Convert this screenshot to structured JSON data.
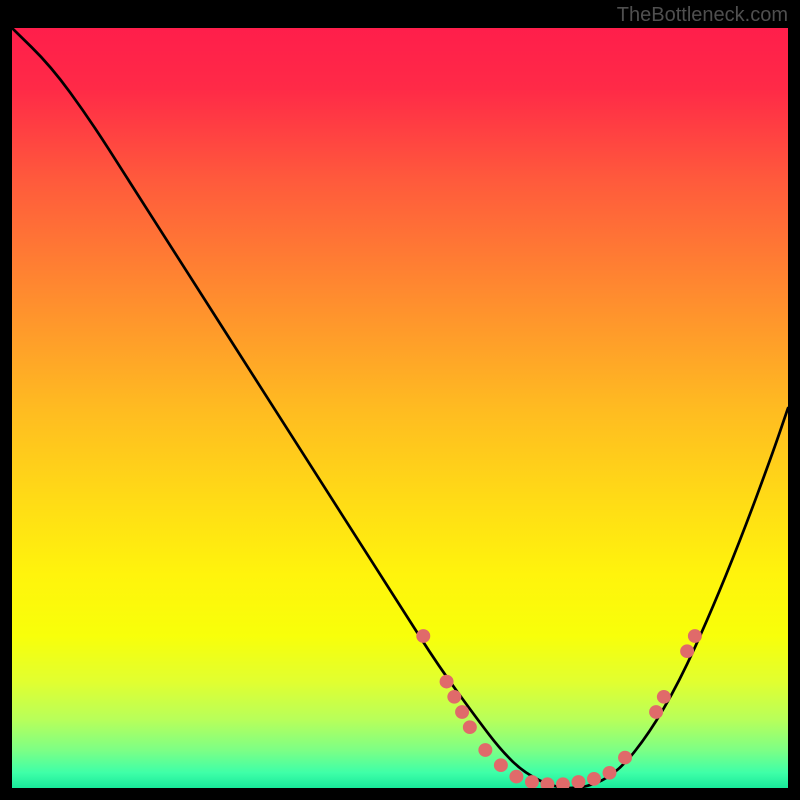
{
  "watermark": "TheBottleneck.com",
  "chart_data": {
    "type": "line",
    "title": "",
    "xlabel": "",
    "ylabel": "",
    "xlim": [
      0,
      100
    ],
    "ylim": [
      0,
      100
    ],
    "grid": false,
    "legend": false,
    "gradient_stops": [
      {
        "offset": "0%",
        "color": "#ff1e4b"
      },
      {
        "offset": "8%",
        "color": "#ff2a47"
      },
      {
        "offset": "20%",
        "color": "#ff5a3c"
      },
      {
        "offset": "35%",
        "color": "#ff8b2f"
      },
      {
        "offset": "50%",
        "color": "#ffbb21"
      },
      {
        "offset": "62%",
        "color": "#ffdb16"
      },
      {
        "offset": "72%",
        "color": "#fff40c"
      },
      {
        "offset": "80%",
        "color": "#f8ff0a"
      },
      {
        "offset": "86%",
        "color": "#e1ff30"
      },
      {
        "offset": "91%",
        "color": "#b8ff5a"
      },
      {
        "offset": "95%",
        "color": "#7dff85"
      },
      {
        "offset": "98%",
        "color": "#3effa8"
      },
      {
        "offset": "100%",
        "color": "#18e99a"
      }
    ],
    "series": [
      {
        "name": "bottleneck-curve",
        "x": [
          0,
          5,
          10,
          15,
          20,
          25,
          30,
          35,
          40,
          45,
          50,
          55,
          60,
          63,
          66,
          70,
          74,
          78,
          82,
          86,
          90,
          94,
          98,
          100
        ],
        "y": [
          100,
          95,
          88,
          80,
          72,
          64,
          56,
          48,
          40,
          32,
          24,
          16,
          9,
          5,
          2,
          0,
          0,
          2,
          7,
          14,
          23,
          33,
          44,
          50
        ]
      }
    ],
    "markers": {
      "name": "highlight-points",
      "color": "#e06a6a",
      "radius": 5,
      "points": [
        {
          "x": 53,
          "y": 20
        },
        {
          "x": 56,
          "y": 14
        },
        {
          "x": 57,
          "y": 12
        },
        {
          "x": 58,
          "y": 10
        },
        {
          "x": 59,
          "y": 8
        },
        {
          "x": 61,
          "y": 5
        },
        {
          "x": 63,
          "y": 3
        },
        {
          "x": 65,
          "y": 1.5
        },
        {
          "x": 67,
          "y": 0.8
        },
        {
          "x": 69,
          "y": 0.5
        },
        {
          "x": 71,
          "y": 0.5
        },
        {
          "x": 73,
          "y": 0.8
        },
        {
          "x": 75,
          "y": 1.2
        },
        {
          "x": 77,
          "y": 2
        },
        {
          "x": 79,
          "y": 4
        },
        {
          "x": 83,
          "y": 10
        },
        {
          "x": 84,
          "y": 12
        },
        {
          "x": 87,
          "y": 18
        },
        {
          "x": 88,
          "y": 20
        }
      ]
    }
  }
}
